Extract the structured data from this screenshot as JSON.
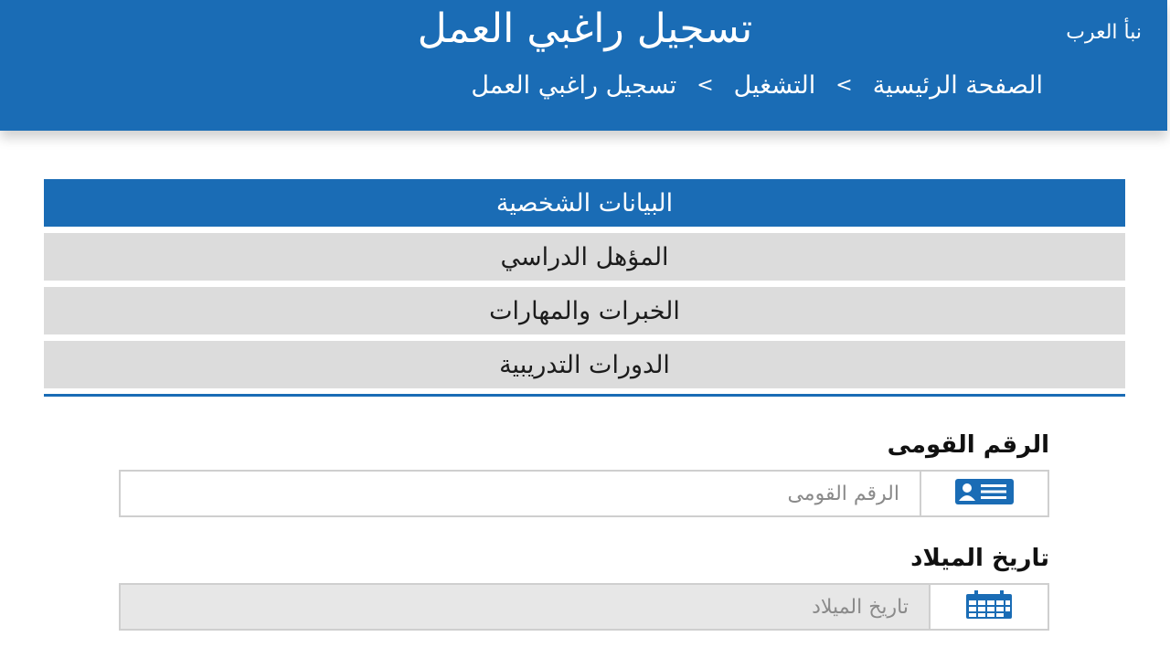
{
  "header": {
    "title": "تسجيل راغبي العمل",
    "watermark": "نبأ العرب",
    "breadcrumb": {
      "items": [
        "الصفحة الرئيسية",
        "التشغيل",
        "تسجيل راغبي العمل"
      ],
      "separator": ">"
    }
  },
  "tabs": [
    {
      "label": "البيانات الشخصية",
      "active": true
    },
    {
      "label": "المؤهل الدراسي",
      "active": false
    },
    {
      "label": "الخبرات والمهارات",
      "active": false
    },
    {
      "label": "الدورات التدريبية",
      "active": false
    }
  ],
  "form": {
    "national_id": {
      "label": "الرقم القومى",
      "placeholder": "الرقم القومى",
      "value": "",
      "icon": "id-card-icon"
    },
    "birth_date": {
      "label": "تاريخ الميلاد",
      "placeholder": "تاريخ الميلاد",
      "value": "",
      "icon": "calendar-icon"
    }
  },
  "colors": {
    "primary": "#1a6cb5",
    "tab_inactive": "#dcdcdc",
    "input_border": "#cfcfcf",
    "input_disabled": "#e7e7e7"
  }
}
